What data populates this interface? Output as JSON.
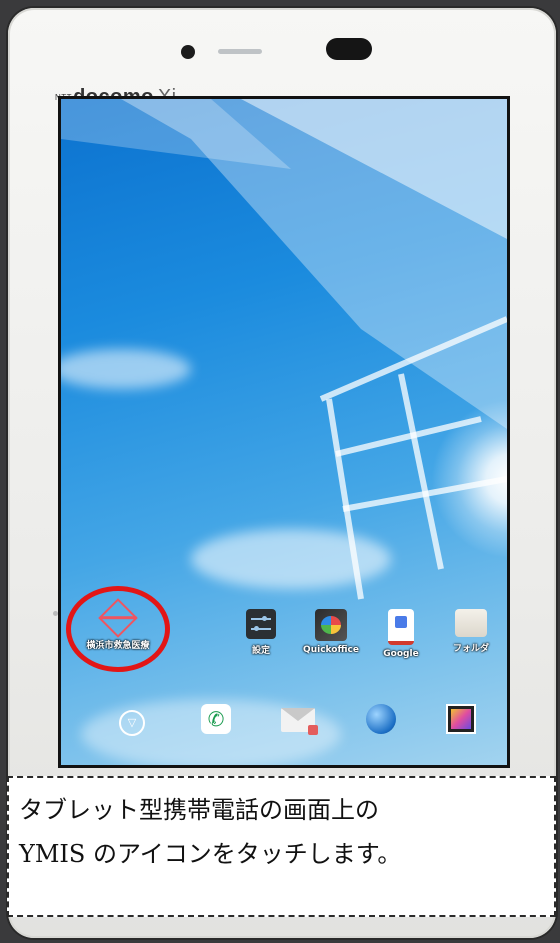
{
  "device": {
    "brand": "docomo",
    "brand_prefix": "NTT",
    "model_mark": "Xi"
  },
  "home_screen": {
    "ymis_app": {
      "label": "横浜市救急医療",
      "icon": "ymis-diamond-icon",
      "highlighted": true
    },
    "apps": [
      {
        "label": "設定",
        "icon": "settings-icon"
      },
      {
        "label": "Quickoffice",
        "icon": "quickoffice-icon"
      },
      {
        "label": "Google",
        "icon": "google-icon"
      },
      {
        "label": "フォルダ",
        "icon": "folder-icon"
      }
    ],
    "dock": [
      {
        "icon": "app-drawer-icon"
      },
      {
        "icon": "phone-icon"
      },
      {
        "icon": "mail-icon"
      },
      {
        "icon": "browser-globe-icon"
      },
      {
        "icon": "gallery-icon"
      }
    ]
  },
  "annotation": {
    "color": "#e21616"
  },
  "caption": {
    "line1": "タブレット型携帯電話の画面上の",
    "line2": "YMIS のアイコンをタッチします。"
  }
}
